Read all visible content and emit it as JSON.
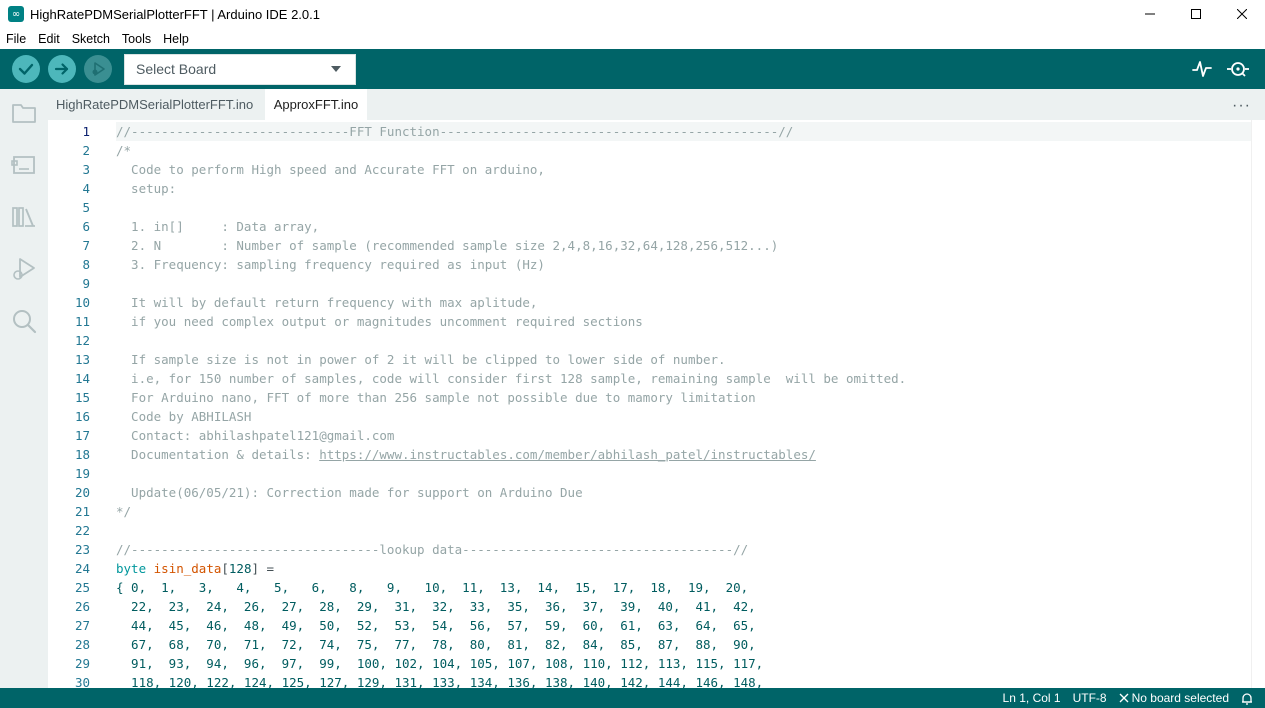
{
  "window": {
    "title": "HighRatePDMSerialPlotterFFT | Arduino IDE 2.0.1",
    "app_icon_glyph": "∞"
  },
  "menu": [
    "File",
    "Edit",
    "Sketch",
    "Tools",
    "Help"
  ],
  "toolbar": {
    "board_select": "Select Board"
  },
  "tabs": [
    {
      "label": "HighRatePDMSerialPlotterFFT.ino",
      "active": false
    },
    {
      "label": "ApproxFFT.ino",
      "active": true
    }
  ],
  "editor": {
    "current_line": 1,
    "line_numbers": [
      "1",
      "2",
      "3",
      "4",
      "5",
      "6",
      "7",
      "8",
      "9",
      "10",
      "11",
      "12",
      "13",
      "14",
      "15",
      "16",
      "17",
      "18",
      "19",
      "20",
      "21",
      "22",
      "23",
      "24",
      "25",
      "26",
      "27",
      "28",
      "29",
      "30"
    ],
    "comment_lines": [
      "//-----------------------------FFT Function---------------------------------------------//",
      "/*",
      "  Code to perform High speed and Accurate FFT on arduino,",
      "  setup:",
      "",
      "  1. in[]     : Data array,",
      "  2. N        : Number of sample (recommended sample size 2,4,8,16,32,64,128,256,512...)",
      "  3. Frequency: sampling frequency required as input (Hz)",
      "",
      "  It will by default return frequency with max aplitude,",
      "  if you need complex output or magnitudes uncomment required sections",
      "",
      "  If sample size is not in power of 2 it will be clipped to lower side of number.",
      "  i.e, for 150 number of samples, code will consider first 128 sample, remaining sample  will be omitted.",
      "  For Arduino nano, FFT of more than 256 sample not possible due to mamory limitation",
      "  Code by ABHILASH",
      "  Contact: abhilashpatel121@gmail.com"
    ],
    "line18_prefix": "  Documentation & details: ",
    "line18_link": "https://www.instructables.com/member/abhilash_patel/instructables/",
    "comment_lines_b": [
      "",
      "  Update(06/05/21): Correction made for support on Arduino Due",
      "*/",
      "",
      "//---------------------------------lookup data------------------------------------//"
    ],
    "line24": {
      "type": "byte",
      "name": "isin_data",
      "bracket_open": "[",
      "size": "128",
      "bracket_close": "] ="
    },
    "data_lines": [
      "{ 0,  1,   3,   4,   5,   6,   8,   9,   10,  11,  13,  14,  15,  17,  18,  19,  20,",
      "  22,  23,  24,  26,  27,  28,  29,  31,  32,  33,  35,  36,  37,  39,  40,  41,  42,",
      "  44,  45,  46,  48,  49,  50,  52,  53,  54,  56,  57,  59,  60,  61,  63,  64,  65,",
      "  67,  68,  70,  71,  72,  74,  75,  77,  78,  80,  81,  82,  84,  85,  87,  88,  90,",
      "  91,  93,  94,  96,  97,  99,  100, 102, 104, 105, 107, 108, 110, 112, 113, 115, 117,",
      "  118, 120, 122, 124, 125, 127, 129, 131, 133, 134, 136, 138, 140, 142, 144, 146, 148,"
    ]
  },
  "statusbar": {
    "position": "Ln 1, Col 1",
    "encoding": "UTF-8",
    "board": "No board selected"
  },
  "colors": {
    "teal_dark": "#006468",
    "teal_button": "#4db7bb",
    "comment": "#95a5a6",
    "keyword": "#00979c",
    "identifier": "#d35400",
    "number": "#005c5f",
    "line_number": "#237893"
  }
}
